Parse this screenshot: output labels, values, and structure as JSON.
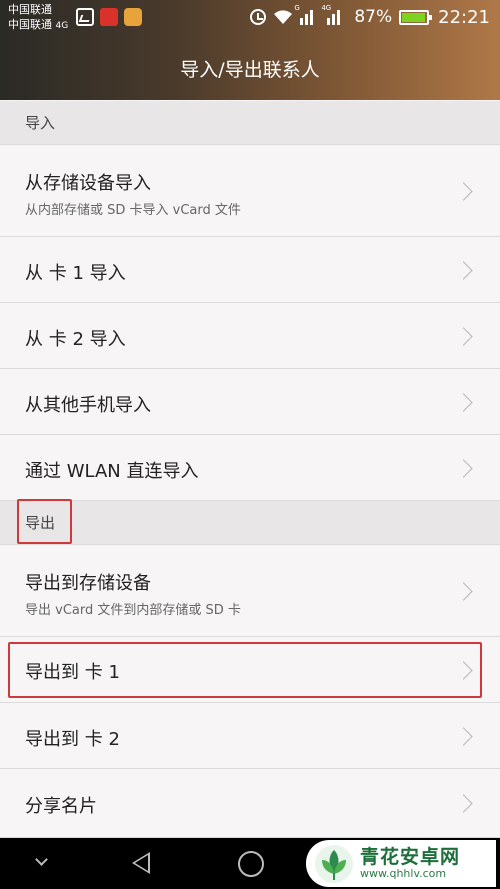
{
  "status_bar": {
    "carrier_line1": "中国联通",
    "carrier_line2": "中国联通",
    "carrier_line2_net": "4G",
    "notification_icons": [
      "gallery-icon",
      "app-icon",
      "app-icon"
    ],
    "signal_tag_1": "G",
    "signal_tag_2": "4G",
    "battery_percent": "87%",
    "battery_level": 0.87,
    "battery_color": "#7ed321",
    "time": "22:21"
  },
  "header": {
    "title": "导入/导出联系人"
  },
  "import_section": {
    "header": "导入",
    "items": [
      {
        "title": "从存储设备导入",
        "subtitle": "从内部存储或 SD 卡导入 vCard 文件"
      },
      {
        "title": "从 卡 1 导入"
      },
      {
        "title": "从 卡 2 导入"
      },
      {
        "title": "从其他手机导入"
      },
      {
        "title": "通过 WLAN 直连导入"
      }
    ]
  },
  "export_section": {
    "header": "导出",
    "items": [
      {
        "title": "导出到存储设备",
        "subtitle": "导出 vCard 文件到内部存储或 SD 卡"
      },
      {
        "title": "导出到 卡 1"
      },
      {
        "title": "导出到 卡 2"
      },
      {
        "title": "分享名片"
      }
    ]
  },
  "annotation_color": "#d0393c",
  "nav_bar": {
    "buttons": [
      "hide-icon",
      "back-icon",
      "home-icon",
      "recent-apps-icon"
    ]
  },
  "watermark": {
    "name": "青花安卓网",
    "url": "www.qhhlv.com"
  }
}
